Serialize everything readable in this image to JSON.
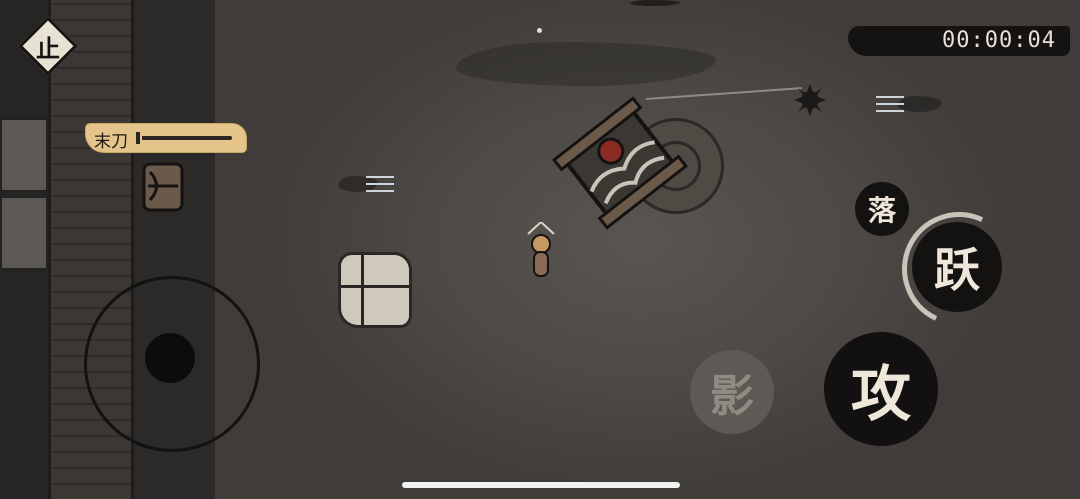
{
  "hud": {
    "pause_label": "止",
    "timer": "00:00:04"
  },
  "weapon": {
    "name": "末刀",
    "icon": "saber-icon"
  },
  "controls": {
    "fall_label": "落",
    "jump_label": "跃",
    "attack_label": "攻",
    "shadow_label": "影"
  },
  "colors": {
    "ink": "#141210",
    "paper": "#efe8da",
    "weapon_tag": "#e4c48a",
    "ground": "#4d4945"
  }
}
